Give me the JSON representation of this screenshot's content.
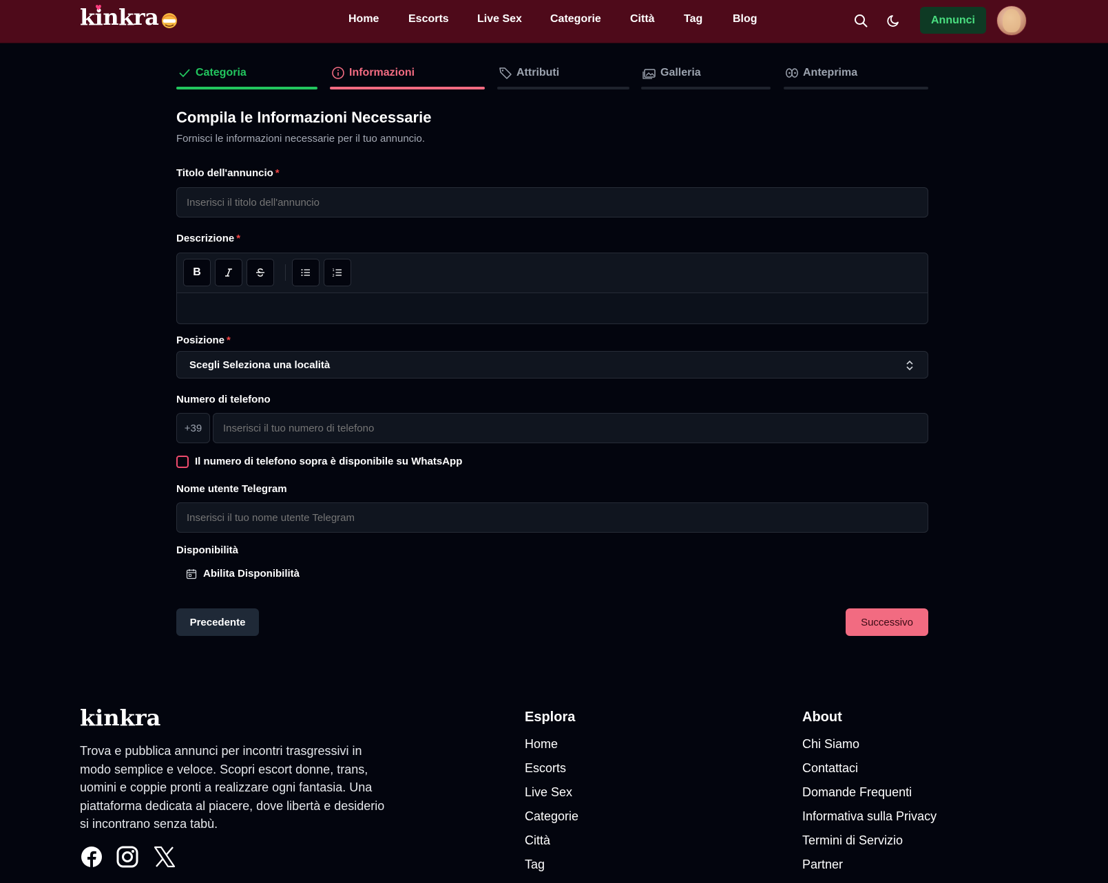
{
  "header": {
    "logo": "kinkra",
    "nav": [
      "Home",
      "Escorts",
      "Live Sex",
      "Categorie",
      "Città",
      "Tag",
      "Blog"
    ],
    "annunci_label": "Annunci",
    "colors": {
      "background": "#4e0a1a",
      "accent_green": "#4ade80"
    }
  },
  "stepper": {
    "steps": [
      {
        "label": "Categoria",
        "status": "completed",
        "icon": "check-icon"
      },
      {
        "label": "Informazioni",
        "status": "active",
        "icon": "info-icon"
      },
      {
        "label": "Attributi",
        "status": "pending",
        "icon": "tag-icon"
      },
      {
        "label": "Galleria",
        "status": "pending",
        "icon": "gallery-icon"
      },
      {
        "label": "Anteprima",
        "status": "pending",
        "icon": "preview-icon"
      }
    ],
    "colors": {
      "completed": "#22c55e",
      "active": "#f26b81",
      "pending": "#9ca3af"
    }
  },
  "form": {
    "title": "Compila le Informazioni Necessarie",
    "subtitle": "Fornisci le informazioni necessarie per il tuo annuncio.",
    "required_marker": "*",
    "title_field": {
      "label": "Titolo dell'annuncio",
      "placeholder": "Inserisci il titolo dell'annuncio",
      "value": ""
    },
    "description": {
      "label": "Descrizione",
      "value": "",
      "toolbar": [
        "bold-icon",
        "italic-icon",
        "strikethrough-icon",
        "bullet-list-icon",
        "numbered-list-icon"
      ]
    },
    "position": {
      "label": "Posizione",
      "selected": "Scegli Seleziona una località"
    },
    "phone": {
      "label": "Numero di telefono",
      "prefix": "+39",
      "placeholder": "Inserisci il tuo numero di telefono",
      "value": ""
    },
    "whatsapp": {
      "label": "Il numero di telefono sopra è disponibile su WhatsApp",
      "checked": false
    },
    "telegram": {
      "label": "Nome utente Telegram",
      "placeholder": "Inserisci il tuo nome utente Telegram",
      "value": ""
    },
    "availability": {
      "label": "Disponibilità",
      "button": "Abilita Disponibilità"
    },
    "prev_button": "Precedente",
    "next_button": "Successivo"
  },
  "footer": {
    "logo": "kinkra",
    "description": "Trova e pubblica annunci per incontri trasgressivi in modo semplice e veloce. Scopri escort donne, trans, uomini e coppie pronti a realizzare ogni fantasia. Una piattaforma dedicata al piacere, dove libertà e desiderio si incontrano senza tabù.",
    "social": [
      "facebook-icon",
      "instagram-icon",
      "x-icon"
    ],
    "explore": {
      "title": "Esplora",
      "links": [
        "Home",
        "Escorts",
        "Live Sex",
        "Categorie",
        "Città",
        "Tag"
      ]
    },
    "about": {
      "title": "About",
      "links": [
        "Chi Siamo",
        "Contattaci",
        "Domande Frequenti",
        "Informativa sulla Privacy",
        "Termini di Servizio",
        "Partner"
      ]
    }
  }
}
